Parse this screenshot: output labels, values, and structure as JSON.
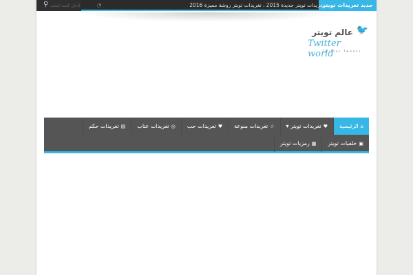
{
  "topbar": {
    "breaking_label": "جديد تغريدات تويتر",
    "ticker": "تغريدات تويتر جديدة 2015 ، تغريدات تويتر روشة مميزة 2016",
    "search_placeholder": "أدخل كلمة البحث",
    "accent": "#36b7e6"
  },
  "logo": {
    "arabic": "عالم تويتر",
    "english": "Twitter world",
    "tagline": "Twitter Tweets"
  },
  "nav": {
    "row1": [
      {
        "label": "الرئيسية",
        "icon": "home-icon",
        "glyph": "⌂",
        "active": true
      },
      {
        "label": "تغريدات تويتر ▾",
        "icon": "twitter-icon",
        "glyph": "♥"
      },
      {
        "label": "تغريدات منوعة",
        "icon": "star-icon",
        "glyph": "☆"
      },
      {
        "label": "تغريدات حب",
        "icon": "heart-icon",
        "glyph": "♥"
      },
      {
        "label": "تغريدات عتاب",
        "icon": "circle-icon",
        "glyph": "◎"
      },
      {
        "label": "تغريدات حكم",
        "icon": "book-icon",
        "glyph": "▤"
      }
    ],
    "row2": [
      {
        "label": "خلفيات تويتر",
        "icon": "image-icon",
        "glyph": "▣"
      },
      {
        "label": "رمزيات تويتر",
        "icon": "briefcase-icon",
        "glyph": "▦"
      }
    ]
  }
}
